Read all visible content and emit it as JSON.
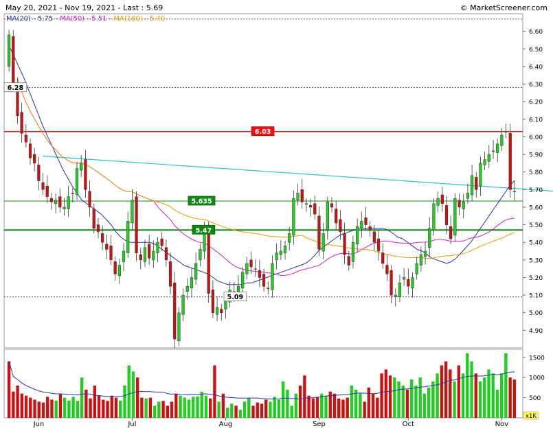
{
  "header": {
    "date_range": "May 20, 2021 - Nov 19, 2021 - Last : 5.69",
    "copyright": "© MarketScreener.com"
  },
  "legend": {
    "ma20": "MA(20) - 5.75",
    "ma50": "MA(50) - 5.51",
    "ma100": "MA(100) - 5.40",
    "sep": " - "
  },
  "colors": {
    "up": "#22cc22",
    "down": "#cc1111",
    "ma20": "#2233aa",
    "ma50": "#cc22cc",
    "ma100": "#ee9900",
    "trend": "#33bbcc",
    "resistance": "#ee1111",
    "support": "#118811",
    "volume_avg": "#2233aa"
  },
  "chart_data": {
    "type": "candlestick",
    "title": "May 20, 2021 - Nov 19, 2021 - Last : 5.69",
    "last": 5.69,
    "ylim": [
      4.8,
      6.7
    ],
    "y_ticks": [
      "4.90",
      "5.00",
      "5.10",
      "5.20",
      "5.30",
      "5.40",
      "5.50",
      "5.60",
      "5.70",
      "5.80",
      "5.90",
      "6.00",
      "6.10",
      "6.20",
      "6.30",
      "6.40",
      "6.50",
      "6.60"
    ],
    "x_labels": [
      {
        "label": "Jun",
        "index": 7
      },
      {
        "label": "Jul",
        "index": 29
      },
      {
        "label": "Aug",
        "index": 51
      },
      {
        "label": "Sep",
        "index": 73
      },
      {
        "label": "Oct",
        "index": 94
      },
      {
        "label": "Nov",
        "index": 116
      }
    ],
    "levels": [
      {
        "label": "6.28",
        "value": 6.28,
        "style": "dotted"
      },
      {
        "label": "6.03",
        "value": 6.03,
        "style": "resistance"
      },
      {
        "label": "5.635",
        "value": 5.635,
        "style": "support"
      },
      {
        "label": "5.47",
        "value": 5.47,
        "style": "support-strong"
      },
      {
        "label": "5.09",
        "value": 5.09,
        "style": "dotted"
      }
    ],
    "top_dotted": 6.67,
    "trendline": {
      "from_index": 8,
      "from_value": 5.89,
      "to_index": 129,
      "to_value": 5.69
    },
    "candles_close": [
      6.58,
      6.3,
      6.12,
      6.02,
      5.97,
      5.88,
      5.85,
      5.75,
      5.7,
      5.66,
      5.63,
      5.64,
      5.6,
      5.6,
      5.66,
      5.68,
      5.82,
      5.85,
      5.7,
      5.6,
      5.48,
      5.46,
      5.4,
      5.36,
      5.3,
      5.22,
      5.27,
      5.35,
      5.52,
      5.64,
      5.34,
      5.3,
      5.37,
      5.31,
      5.35,
      5.4,
      5.38,
      5.3,
      5.15,
      4.85,
      5.0,
      5.1,
      5.15,
      5.2,
      5.28,
      5.36,
      5.48,
      5.11,
      5.0,
      5.03,
      5.0,
      5.07,
      5.13,
      5.1,
      5.15,
      5.23,
      5.28,
      5.26,
      5.25,
      5.2,
      5.15,
      5.14,
      5.28,
      5.34,
      5.35,
      5.38,
      5.45,
      5.65,
      5.68,
      5.63,
      5.62,
      5.6,
      5.56,
      5.36,
      5.45,
      5.63,
      5.6,
      5.51,
      5.46,
      5.33,
      5.27,
      5.4,
      5.49,
      5.52,
      5.5,
      5.47,
      5.4,
      5.35,
      5.28,
      5.22,
      5.1,
      5.1,
      5.17,
      5.2,
      5.15,
      5.2,
      5.28,
      5.33,
      5.35,
      5.48,
      5.62,
      5.65,
      5.62,
      5.5,
      5.42,
      5.65,
      5.6,
      5.63,
      5.68,
      5.78,
      5.7,
      5.85,
      5.87,
      5.9,
      5.92,
      5.96,
      6.01,
      6.03,
      5.7,
      5.69
    ],
    "ma20": [
      6.52,
      6.46,
      6.4,
      6.34,
      6.27,
      6.2,
      6.13,
      6.06,
      6.0,
      5.94,
      5.88,
      5.82,
      5.77,
      5.72,
      5.68,
      5.64,
      5.62,
      5.6,
      5.58,
      5.56,
      5.53,
      5.5,
      5.46,
      5.43,
      5.41,
      5.4,
      5.4,
      5.4,
      5.4,
      5.4,
      5.39,
      5.37,
      5.35,
      5.33,
      5.31,
      5.29,
      5.27,
      5.26,
      5.25,
      5.24,
      5.23,
      5.22,
      5.2,
      5.18,
      5.17,
      5.16,
      5.16,
      5.16,
      5.16,
      5.17,
      5.17,
      5.18,
      5.19,
      5.2,
      5.21,
      5.22,
      5.23,
      5.24,
      5.25,
      5.26,
      5.27,
      5.28,
      5.3,
      5.33,
      5.36,
      5.38,
      5.4,
      5.42,
      5.44,
      5.45,
      5.46,
      5.47,
      5.48,
      5.48,
      5.48,
      5.48,
      5.48,
      5.48,
      5.47,
      5.45,
      5.43,
      5.42,
      5.4,
      5.38,
      5.36,
      5.35,
      5.33,
      5.31,
      5.3,
      5.29,
      5.28,
      5.29,
      5.31,
      5.34,
      5.37,
      5.4,
      5.44,
      5.48,
      5.52,
      5.56,
      5.6,
      5.64,
      5.68,
      5.72,
      5.75
    ],
    "volume": {
      "y_ticks": [
        "500",
        "1000",
        "1500"
      ],
      "ylim": [
        0,
        1700
      ],
      "unit_label": "x1K",
      "values": [
        1400,
        650,
        800,
        600,
        550,
        500,
        450,
        400,
        380,
        520,
        450,
        430,
        600,
        500,
        430,
        520,
        420,
        1000,
        700,
        480,
        800,
        550,
        450,
        420,
        550,
        500,
        430,
        800,
        1300,
        1150,
        1000,
        500,
        480,
        500,
        300,
        400,
        420,
        300,
        400,
        600,
        550,
        500,
        450,
        520,
        530,
        650,
        550,
        480,
        1300,
        400,
        600,
        250,
        350,
        300,
        200,
        400,
        500,
        300,
        380,
        350,
        450,
        400,
        520,
        450,
        900,
        700,
        300,
        600,
        800,
        1050,
        550,
        480,
        520,
        600,
        550,
        650,
        600,
        480,
        450,
        500,
        800,
        700,
        600,
        400,
        750,
        600,
        500,
        1100,
        1200,
        1050,
        1000,
        900,
        800,
        700,
        950,
        800,
        1000,
        600,
        750,
        900,
        1100,
        1300,
        1400,
        1200,
        900,
        1300,
        1100,
        1600,
        1400,
        1100,
        900,
        1000,
        1200,
        1100,
        700,
        1100,
        1600,
        1000,
        950
      ]
    }
  }
}
